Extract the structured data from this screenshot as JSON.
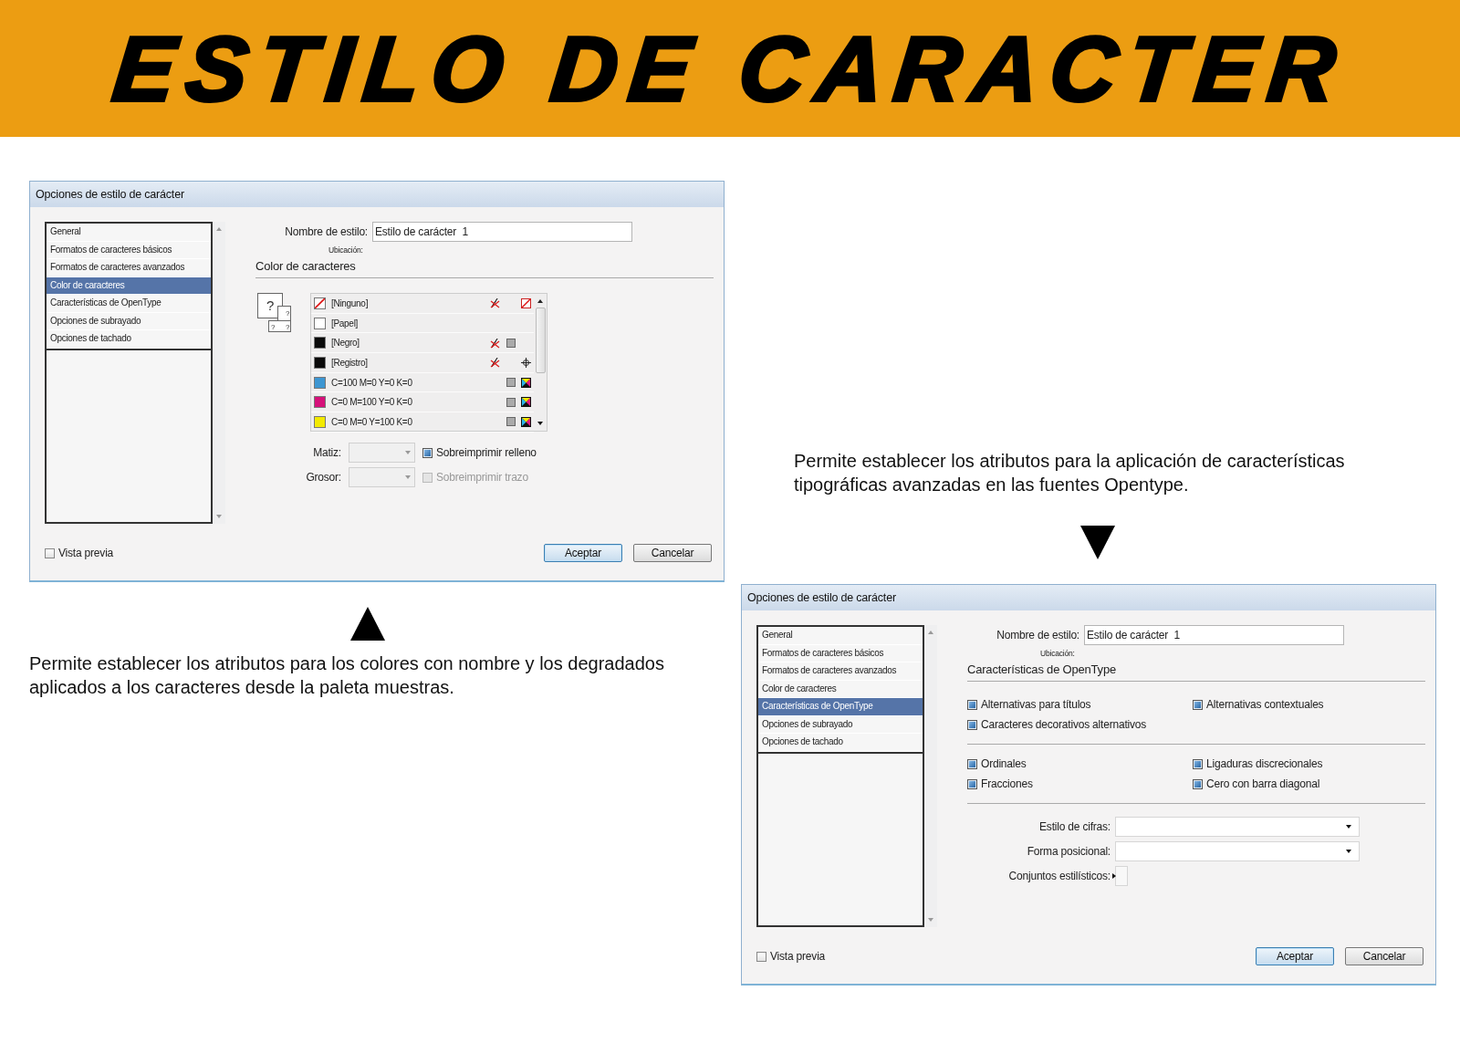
{
  "banner": {
    "title": "ESTILO DE CARACTER"
  },
  "columns": [
    {
      "kind": "dialog-then-caption",
      "caption": "Permite establecer los atributos para los colores con nombre y los degradados aplicados a los caracteres desde la paleta muestras.",
      "dialog": {
        "title": "Opciones de estilo de carácter",
        "categories": [
          {
            "label": "General",
            "selected": false
          },
          {
            "label": "Formatos de caracteres básicos",
            "selected": false
          },
          {
            "label": "Formatos de caracteres avanzados",
            "selected": false
          },
          {
            "label": "Color de caracteres",
            "selected": true
          },
          {
            "label": "Características de OpenType",
            "selected": false
          },
          {
            "label": "Opciones de subrayado",
            "selected": false
          },
          {
            "label": "Opciones de tachado",
            "selected": false
          }
        ],
        "name_label": "Nombre de estilo:",
        "name_value": "Estilo de carácter  1",
        "location_label": "Ubicación:",
        "section_title": "Color de caracteres",
        "content": {
          "kind": "swatches",
          "preview_marks": [
            "?",
            "?",
            "?",
            "?"
          ],
          "swatches": [
            {
              "name": "[Ninguno]",
              "kind": "none",
              "color": "#ffffff"
            },
            {
              "name": "[Papel]",
              "kind": "paper",
              "color": "#ffffff"
            },
            {
              "name": "[Negro]",
              "kind": "black",
              "color": "#0a0a0a"
            },
            {
              "name": "[Registro]",
              "kind": "registration",
              "color": "#0a0a0a"
            },
            {
              "name": "C=100 M=0 Y=0 K=0",
              "kind": "process",
              "color": "#3d96d2"
            },
            {
              "name": "C=0 M=100 Y=0 K=0",
              "kind": "process",
              "color": "#d6117a"
            },
            {
              "name": "C=0 M=0 Y=100 K=0",
              "kind": "process",
              "color": "#f3ea00"
            }
          ],
          "tint": {
            "label": "Matiz:",
            "disabled": true
          },
          "stroke": {
            "label": "Grosor:",
            "disabled": true
          },
          "overprint_fill": {
            "label": "Sobreimprimir relleno",
            "checked": true,
            "disabled": false
          },
          "overprint_stroke": {
            "label": "Sobreimprimir trazo",
            "checked": false,
            "disabled": true
          }
        },
        "preview": {
          "label": "Vista previa",
          "checked": false
        },
        "buttons": [
          {
            "label": "Aceptar",
            "default": true
          },
          {
            "label": "Cancelar",
            "default": false
          }
        ]
      }
    },
    {
      "kind": "caption-then-dialog",
      "caption": "Permite establecer los atributos para la aplicación de características tipográficas avanzadas en las fuentes Opentype.",
      "dialog": {
        "title": "Opciones de estilo de carácter",
        "categories": [
          {
            "label": "General",
            "selected": false
          },
          {
            "label": "Formatos de caracteres básicos",
            "selected": false
          },
          {
            "label": "Formatos de caracteres avanzados",
            "selected": false
          },
          {
            "label": "Color de caracteres",
            "selected": false
          },
          {
            "label": "Características de OpenType",
            "selected": true
          },
          {
            "label": "Opciones de subrayado",
            "selected": false
          },
          {
            "label": "Opciones de tachado",
            "selected": false
          }
        ],
        "name_label": "Nombre de estilo:",
        "name_value": "Estilo de carácter  1",
        "location_label": "Ubicación:",
        "section_title": "Características de OpenType",
        "content": {
          "kind": "opentype",
          "groups": [
            [
              [
                {
                  "label": "Alternativas para títulos",
                  "checked": true
                },
                {
                  "label": "Alternativas contextuales",
                  "checked": true
                }
              ],
              [
                {
                  "label": "Caracteres decorativos alternativos",
                  "checked": true
                }
              ]
            ],
            [
              [
                {
                  "label": "Ordinales",
                  "checked": true
                },
                {
                  "label": "Ligaduras discrecionales",
                  "checked": true
                }
              ],
              [
                {
                  "label": "Fracciones",
                  "checked": true
                },
                {
                  "label": "Cero con barra diagonal",
                  "checked": true
                }
              ]
            ]
          ],
          "selects": [
            {
              "label": "Estilo de cifras:",
              "kind": "dropdown"
            },
            {
              "label": "Forma posicional:",
              "kind": "dropdown"
            },
            {
              "label": "Conjuntos estilísticos:",
              "kind": "submenu"
            }
          ]
        },
        "preview": {
          "label": "Vista previa",
          "checked": false
        },
        "buttons": [
          {
            "label": "Aceptar",
            "default": true
          },
          {
            "label": "Cancelar",
            "default": false
          }
        ]
      }
    }
  ]
}
